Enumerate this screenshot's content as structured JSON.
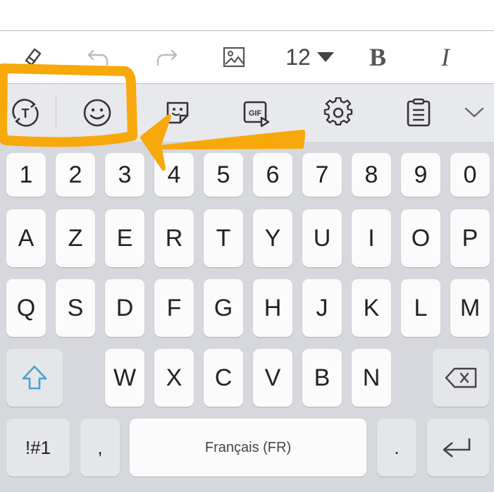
{
  "format_toolbar": {
    "font_size": "12",
    "bold_label": "B",
    "italic_label": "I",
    "icons": [
      "eraser-icon",
      "undo-icon",
      "redo-icon",
      "image-icon",
      "dropdown-arrow-icon"
    ]
  },
  "keyboard_toolbar": {
    "icons": [
      "text-mode-toggle-icon",
      "emoji-icon",
      "sticker-icon",
      "gif-icon",
      "settings-icon",
      "clipboard-icon",
      "collapse-chevron-icon"
    ],
    "gif_label": "GIF"
  },
  "keyboard": {
    "number_row": [
      "1",
      "2",
      "3",
      "4",
      "5",
      "6",
      "7",
      "8",
      "9",
      "0"
    ],
    "row1": [
      "A",
      "Z",
      "E",
      "R",
      "T",
      "Y",
      "U",
      "I",
      "O",
      "P"
    ],
    "row2": [
      "Q",
      "S",
      "D",
      "F",
      "G",
      "H",
      "J",
      "K",
      "L",
      "M"
    ],
    "row3": [
      "W",
      "X",
      "C",
      "V",
      "B",
      "N"
    ],
    "symbols_label": "!#1",
    "comma_label": ",",
    "space_label": "Français (FR)",
    "period_label": "."
  },
  "annotation": {
    "color": "#F7A80A",
    "description_shapes": [
      "highlight-rectangle",
      "arrow"
    ]
  },
  "colors": {
    "shift_accent": "#4a9fd4",
    "keyboard_bg": "#d6d8dd",
    "key_bg": "#fbfbfc"
  }
}
